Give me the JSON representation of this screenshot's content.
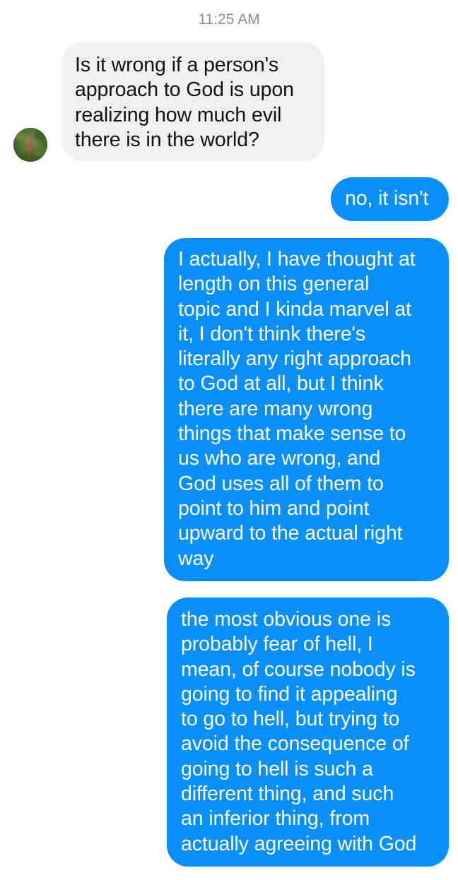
{
  "conversation": {
    "timestamp": "11:25 AM",
    "messages": [
      {
        "sender": "contact",
        "text": "Is it wrong if a person's\napproach to God is upon\nrealizing how much evil\nthere is in the world?"
      },
      {
        "sender": "me",
        "text": "no, it isn't"
      },
      {
        "sender": "me",
        "text": "I actually, I have thought at\nlength on this general\ntopic and I kinda marvel at\nit, I don't think there's\nliterally any right approach\nto God at all, but I think\nthere are many wrong\nthings that make sense to\nus who are wrong, and\nGod uses all of them to\npoint to him and point\nupward to the actual right\nway"
      },
      {
        "sender": "me",
        "text": "the most obvious one is\nprobably fear of hell, I\nmean, of course nobody is\ngoing to find it appealing\nto go to hell, but trying to\navoid the consequence of\ngoing to hell is such a\ndifferent thing, and such\nan inferior thing, from\nactually agreeing with God"
      }
    ]
  },
  "colors": {
    "incoming_bubble": "#f0f0f0",
    "outgoing_bubble": "#0a8ff8",
    "timestamp_text": "#8a8d91"
  },
  "icons": {
    "avatar": "contact-avatar-photo"
  }
}
